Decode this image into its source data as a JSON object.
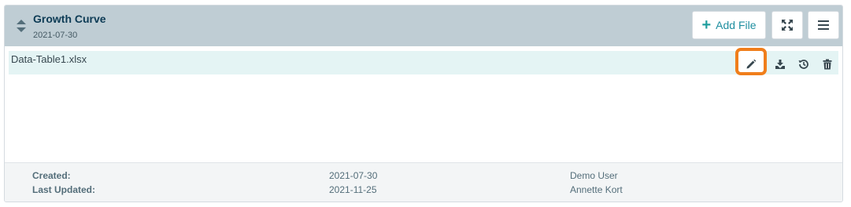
{
  "card": {
    "title": "Growth Curve",
    "date": "2021-07-30"
  },
  "toolbar": {
    "add_file_label": "Add File"
  },
  "files": [
    {
      "name": "Data-Table1.xlsx"
    }
  ],
  "footer": {
    "created_label": "Created:",
    "created_date": "2021-07-30",
    "created_by": "Demo User",
    "updated_label": "Last Updated:",
    "updated_date": "2021-11-25",
    "updated_by": "Annette Kort"
  },
  "icons": {
    "sort": "sort-icon",
    "add": "plus-icon",
    "expand": "expand-icon",
    "menu": "hamburger-menu-icon",
    "edit": "pencil-icon",
    "download": "download-icon",
    "history": "history-icon",
    "delete": "trash-icon"
  },
  "colors": {
    "header_bg": "#bfcdd4",
    "title": "#0d3b55",
    "accent": "#1f9e9e",
    "row_bg": "#e4f4f4",
    "highlight": "#f07e1b"
  }
}
